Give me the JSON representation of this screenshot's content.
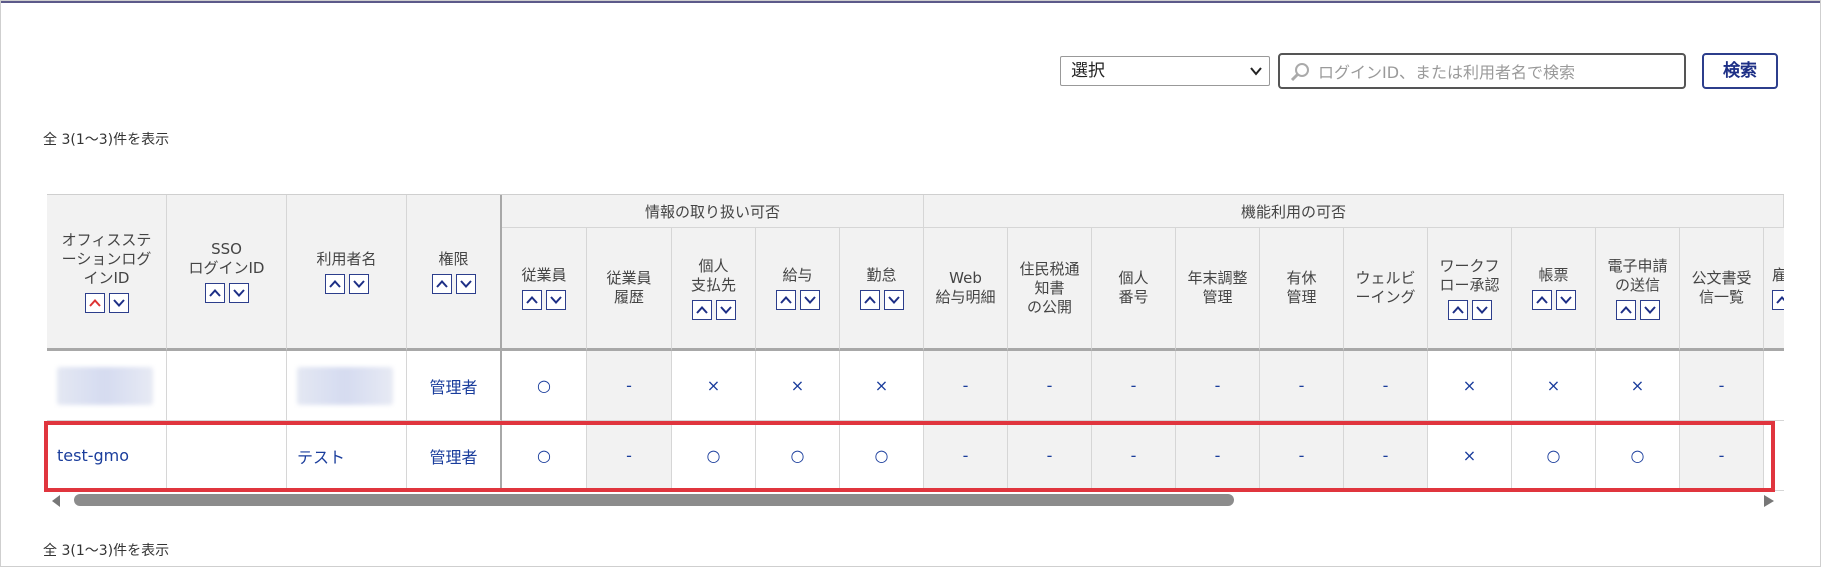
{
  "search": {
    "select_value": "選択",
    "placeholder": "ログインID、または利用者名で検索",
    "button_label": "検索"
  },
  "summary_top": "全 3(1～3)件を表示",
  "summary_bottom": "全 3(1～3)件を表示",
  "groups": {
    "info": "情報の取り扱い可否",
    "features": "機能利用の可否"
  },
  "columns": [
    {
      "key": "office_login_id",
      "label": "オフィスステ\nーションログ\nインID",
      "sortable": true,
      "sort_active_up": true
    },
    {
      "key": "sso_login_id",
      "label": "SSO\nログインID",
      "sortable": true
    },
    {
      "key": "user_name",
      "label": "利用者名",
      "sortable": true
    },
    {
      "key": "role",
      "label": "権限",
      "sortable": true
    },
    {
      "key": "employee",
      "label": "従業員",
      "sortable": true
    },
    {
      "key": "employee_history",
      "label": "従業員\n履歴",
      "sortable": false
    },
    {
      "key": "individual_payee",
      "label": "個人\n支払先",
      "sortable": true
    },
    {
      "key": "salary",
      "label": "給与",
      "sortable": true
    },
    {
      "key": "attendance",
      "label": "勤怠",
      "sortable": true
    },
    {
      "key": "web_payslip",
      "label": "Web\n給与明細",
      "sortable": false
    },
    {
      "key": "resident_tax",
      "label": "住民税通\n知書\nの公開",
      "sortable": false
    },
    {
      "key": "my_number",
      "label": "個人\n番号",
      "sortable": false
    },
    {
      "key": "year_end",
      "label": "年末調整\n管理",
      "sortable": false
    },
    {
      "key": "paid_leave",
      "label": "有休\n管理",
      "sortable": false
    },
    {
      "key": "wellbeing",
      "label": "ウェルビ\nーイング",
      "sortable": false
    },
    {
      "key": "workflow",
      "label": "ワークフ\nロー承認",
      "sortable": true
    },
    {
      "key": "forms",
      "label": "帳票",
      "sortable": true
    },
    {
      "key": "e_application",
      "label": "電子申請\nの送信",
      "sortable": true
    },
    {
      "key": "official_docs",
      "label": "公文書受\n信一覧",
      "sortable": false
    },
    {
      "key": "next",
      "label": "雇",
      "sortable": true
    }
  ],
  "rows": [
    {
      "office_login_id": "",
      "sso_login_id": "",
      "user_name": "",
      "role": "管理者",
      "values": [
        "○",
        "-",
        "×",
        "×",
        "×",
        "-",
        "-",
        "-",
        "-",
        "-",
        "-",
        "×",
        "×",
        "×",
        "-"
      ]
    },
    {
      "office_login_id": "test-gmo",
      "sso_login_id": "",
      "user_name": "テスト",
      "role": "管理者",
      "values": [
        "○",
        "-",
        "○",
        "○",
        "○",
        "-",
        "-",
        "-",
        "-",
        "-",
        "-",
        "×",
        "○",
        "○",
        "-"
      ]
    }
  ],
  "colors": {
    "accent": "#2c3e8c",
    "link": "#1a3d9c",
    "highlight": "#e0353e",
    "header_bg": "#f2f2f2"
  }
}
